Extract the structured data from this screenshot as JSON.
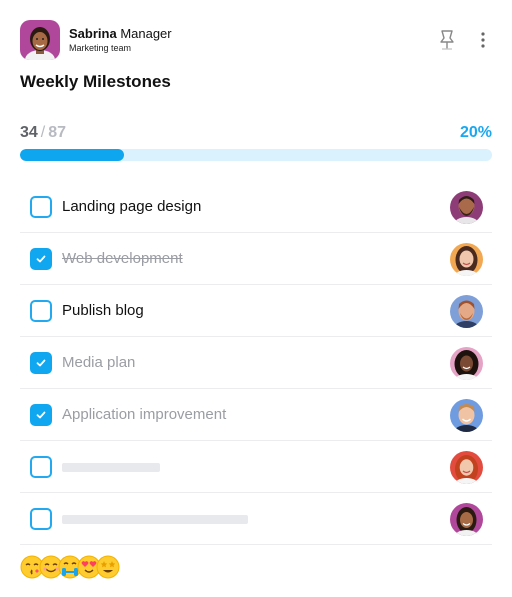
{
  "header": {
    "user_first_name": "Sabrina",
    "user_last_name": "Manager",
    "user_role": "Marketing team",
    "avatar_icon": "woman-avatar",
    "pin_icon": "pin-icon",
    "more_icon": "more-vertical-icon"
  },
  "title": "Weekly Milestones",
  "progress": {
    "done": "34",
    "separator": "/",
    "total": "87",
    "percent_label": "20%",
    "fraction": 0.22
  },
  "colors": {
    "accent": "#10a6f0",
    "track": "#d9f2fd",
    "muted_text": "#9a9da3"
  },
  "tasks": [
    {
      "label": "Landing page design",
      "done": false,
      "strike": false,
      "assignee_icon": "man-beard-avatar"
    },
    {
      "label": "Web development",
      "done": true,
      "strike": true,
      "assignee_icon": "woman-avatar"
    },
    {
      "label": "Publish blog",
      "done": false,
      "strike": false,
      "assignee_icon": "man-avatar"
    },
    {
      "label": "Media plan",
      "done": true,
      "strike": false,
      "assignee_icon": "woman-curly-avatar"
    },
    {
      "label": "Application improvement",
      "done": true,
      "strike": false,
      "assignee_icon": "man-smiling-avatar"
    },
    {
      "label": "",
      "done": false,
      "strike": false,
      "placeholder": true,
      "assignee_icon": "woman-redhead-avatar"
    },
    {
      "label": "",
      "done": false,
      "strike": false,
      "placeholder": true,
      "assignee_icon": "woman-smiling-avatar"
    }
  ],
  "reactions": [
    "kissing-face-emoji",
    "smiling-face-emoji",
    "hugging-face-emoji",
    "heart-eyes-emoji",
    "star-struck-emoji"
  ]
}
